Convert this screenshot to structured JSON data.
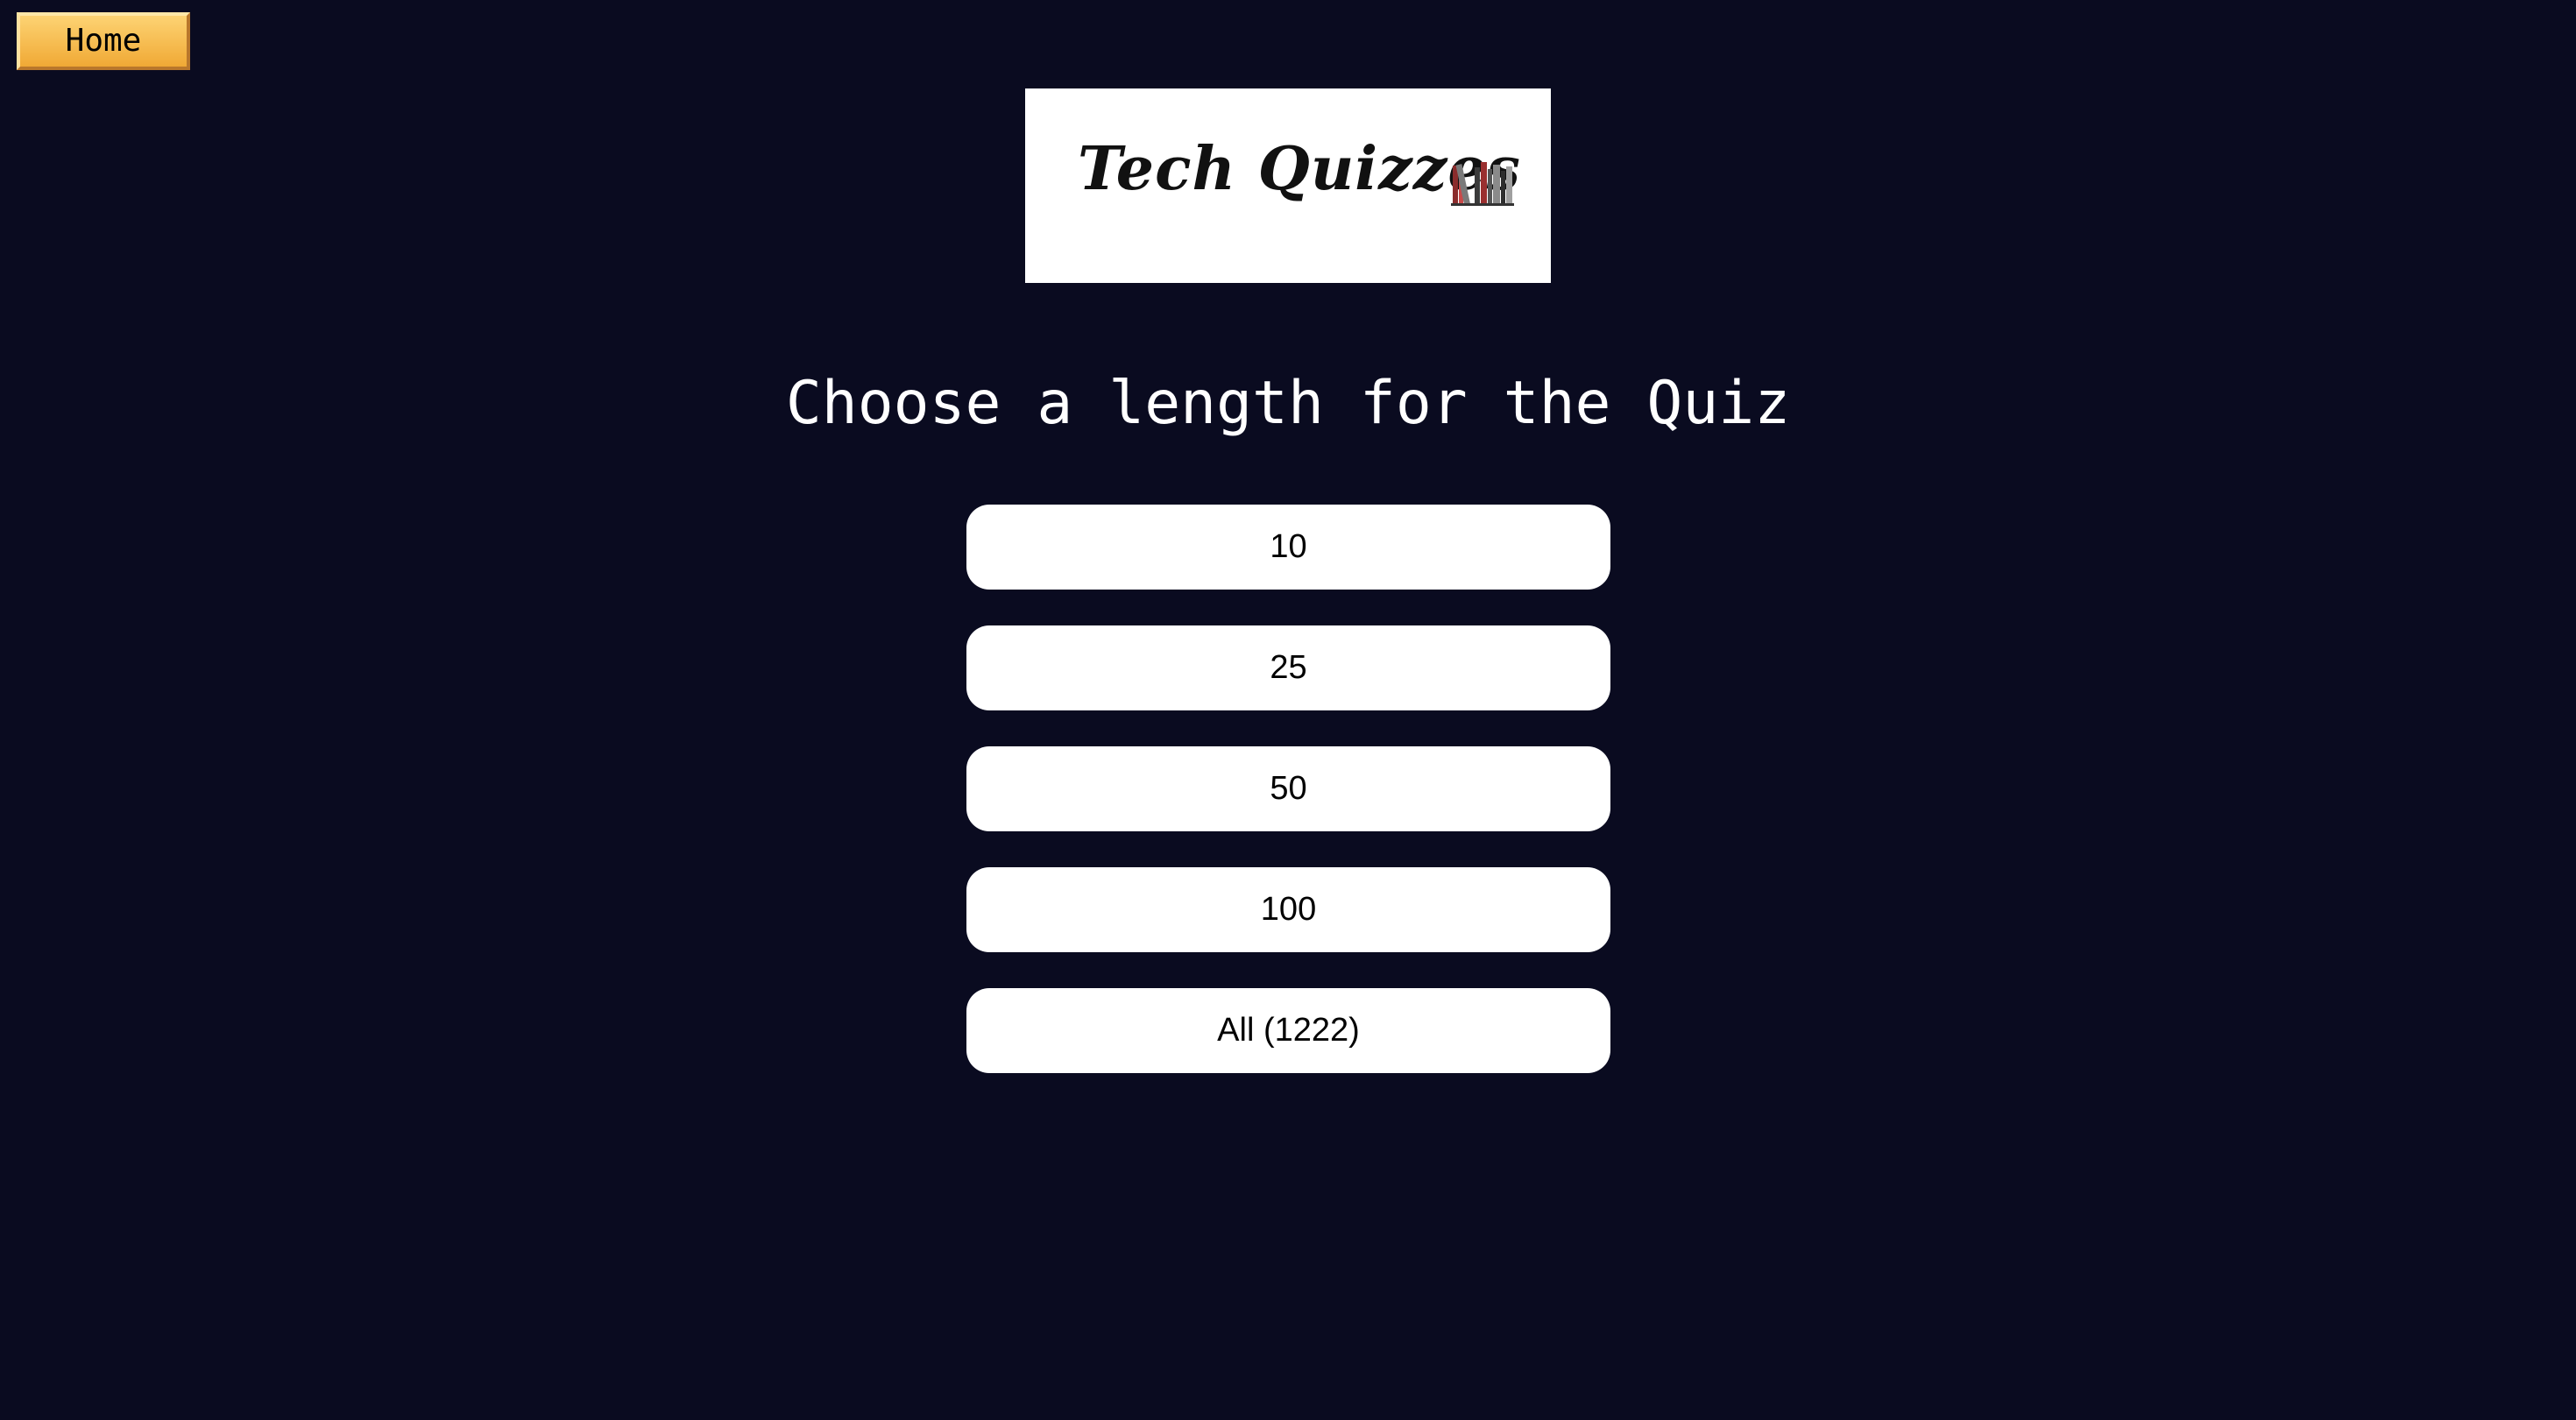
{
  "nav": {
    "home_label": "Home"
  },
  "logo": {
    "text": "Tech Quizzes",
    "icon": "books-icon"
  },
  "heading": "Choose a length for the Quiz",
  "options": [
    {
      "label": "10"
    },
    {
      "label": "25"
    },
    {
      "label": "50"
    },
    {
      "label": "100"
    },
    {
      "label": "All (1222)"
    }
  ],
  "colors": {
    "background": "#0a0b20",
    "home_button": "#f7c05a",
    "option_button": "#ffffff"
  }
}
